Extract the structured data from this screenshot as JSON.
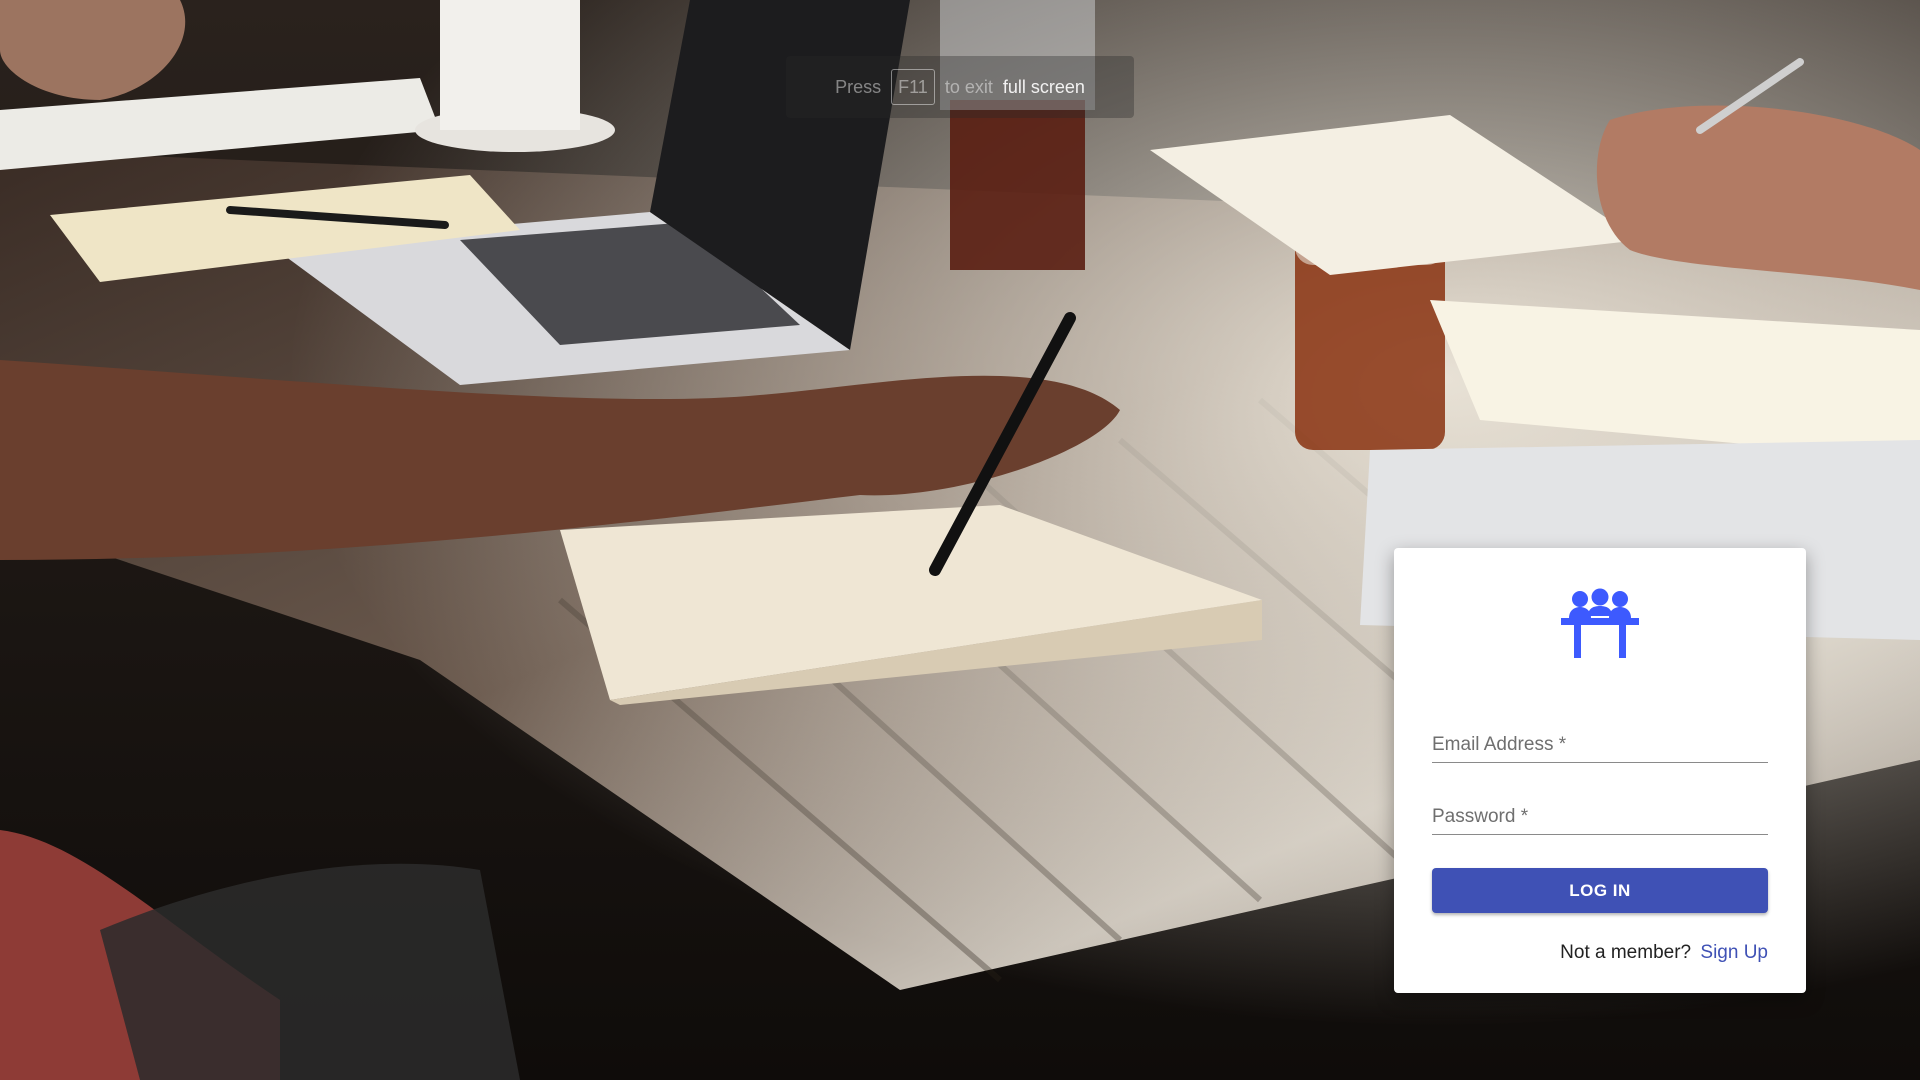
{
  "fullscreen_hint": {
    "press": "Press",
    "key": "F11",
    "to_exit": "to exit",
    "full_screen": "full screen"
  },
  "login": {
    "email_label": "Email Address *",
    "password_label": "Password *",
    "login_button": "LOG IN",
    "not_member": "Not a member?",
    "signup_link": "Sign Up"
  },
  "colors": {
    "primary": "#3f51b5",
    "logo": "#3d5afe",
    "card_bg": "#ffffff"
  },
  "icons": {
    "logo": "team-meeting-icon"
  }
}
